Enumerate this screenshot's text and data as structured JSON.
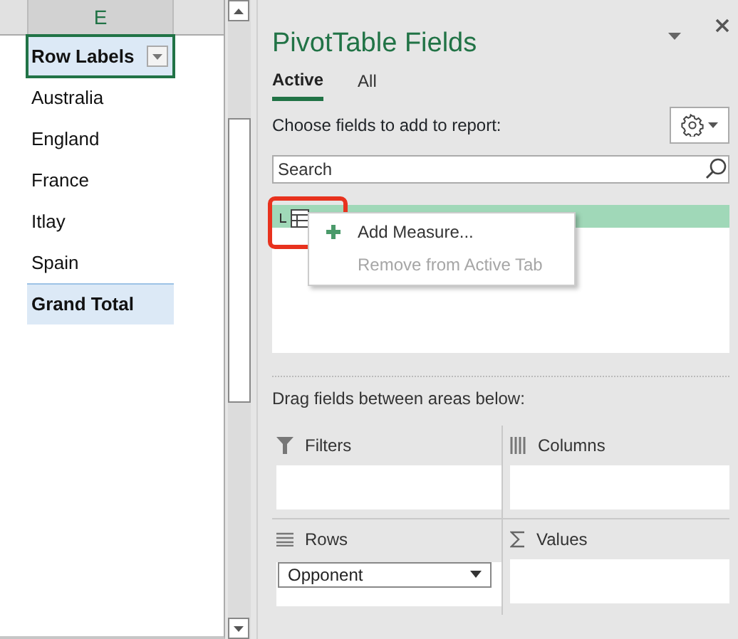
{
  "sheet": {
    "column_header": "E",
    "rows": [
      {
        "text": "Row Labels",
        "kind": "header",
        "selected": true
      },
      {
        "text": "Australia",
        "kind": "item",
        "selected": false
      },
      {
        "text": "England",
        "kind": "item",
        "selected": false
      },
      {
        "text": "France",
        "kind": "item",
        "selected": false
      },
      {
        "text": "Itlay",
        "kind": "item",
        "selected": false
      },
      {
        "text": "Spain",
        "kind": "item",
        "selected": false
      },
      {
        "text": "Grand Total",
        "kind": "total",
        "selected": false
      }
    ]
  },
  "pane": {
    "title": "PivotTable Fields",
    "tabs": [
      {
        "label": "Active",
        "selected": true
      },
      {
        "label": "All",
        "selected": false
      }
    ],
    "instruction": "Choose fields to add to report:",
    "search": {
      "placeholder": "Search"
    },
    "context_menu": [
      {
        "label": "Add Measure...",
        "disabled": false
      },
      {
        "label": "Remove from Active Tab",
        "disabled": true
      }
    ],
    "areas_hint": "Drag fields between areas below:",
    "areas": [
      {
        "name": "Filters",
        "kind": "filters"
      },
      {
        "name": "Columns",
        "kind": "columns"
      },
      {
        "name": "Rows",
        "kind": "rows",
        "fields": [
          "Opponent"
        ]
      },
      {
        "name": "Values",
        "kind": "values"
      }
    ]
  }
}
